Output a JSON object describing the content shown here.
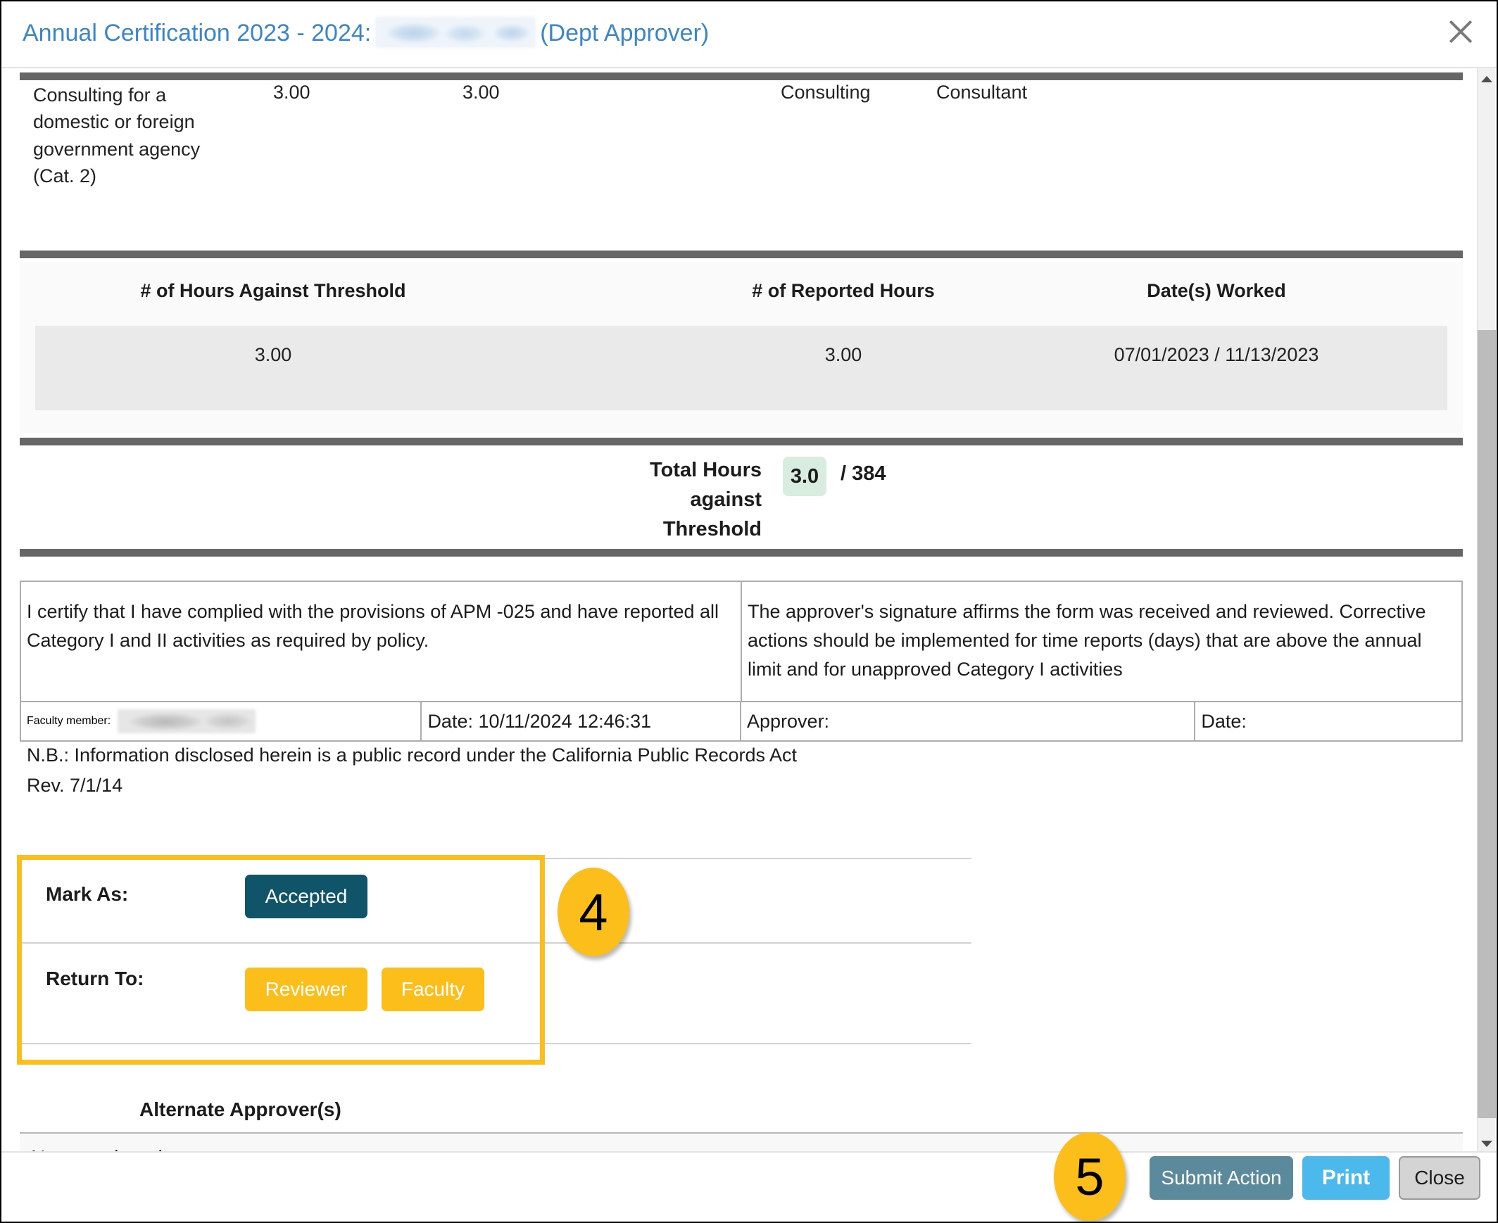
{
  "header": {
    "title_prefix": "Annual Certification 2023 - 2024:",
    "redacted_name": "",
    "role_suffix": "(Dept Approver)",
    "close_icon": "close-icon"
  },
  "activity": {
    "description": "Consulting for a domestic or foreign government agency (Cat. 2)",
    "hours_against_threshold": "3.00",
    "reported_hours": "3.00",
    "category": "Consulting",
    "role": "Consultant"
  },
  "hours_table": {
    "columns": [
      "# of Hours Against Threshold",
      "# of Reported Hours",
      "Date(s) Worked"
    ],
    "rows": [
      {
        "hours_against_threshold": "3.00",
        "reported_hours": "3.00",
        "dates_worked": "07/01/2023 / 11/13/2023"
      }
    ]
  },
  "total": {
    "label": "Total Hours against Threshold",
    "value": "3.0",
    "max": "/ 384",
    "badge_color": "#d8ece0"
  },
  "certification": {
    "faculty_statement": "I certify that I have complied with the provisions of APM -025 and have reported all Category I and II activities as required by policy.",
    "approver_statement": "The approver's signature affirms the form was received and reviewed. Corrective actions should be implemented for time reports (days) that are above the annual limit and for unapproved Category I activities",
    "faculty_member_label": "Faculty member:",
    "faculty_member_value": "",
    "faculty_date": "Date: 10/11/2024 12:46:31",
    "approver_label": "Approver:",
    "approver_value": "",
    "approver_date_label": "Date:",
    "approver_date_value": ""
  },
  "note": {
    "line1": "N.B.: Information disclosed herein is a public record under the California Public Records Act",
    "line2": "Rev. 7/1/14"
  },
  "actions": {
    "mark_as_label": "Mark As:",
    "accepted_label": "Accepted",
    "return_to_label": "Return To:",
    "reviewer_label": "Reviewer",
    "faculty_label": "Faculty",
    "accepted_color": "#0f5468",
    "return_color": "#fcbe1b",
    "highlight_color": "#fcbe1b"
  },
  "alternate_approvers": {
    "title": "Alternate Approver(s)",
    "value": "None assigned"
  },
  "footer": {
    "submit_label": "Submit Action",
    "print_label": "Print",
    "close_label": "Close",
    "submit_color": "#5b8a9c",
    "print_color": "#4cb9ec",
    "close_color": "#d4d4d4"
  },
  "step_markers": {
    "step4": "4",
    "step5": "5"
  },
  "scrollbar": {
    "up_icon": "chevron-up-icon",
    "down_icon": "chevron-down-icon"
  }
}
